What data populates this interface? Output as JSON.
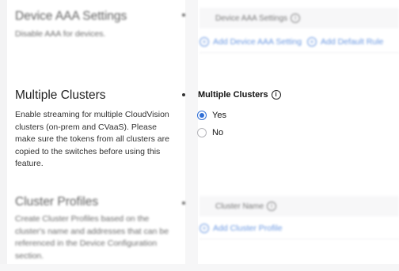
{
  "device_aaa": {
    "title": "Device AAA Settings",
    "description": "Disable AAA for devices.",
    "table_header": "Device AAA Settings",
    "add_setting_label": "Add Device AAA Setting",
    "add_default_rule_label": "Add Default Rule"
  },
  "multiple_clusters": {
    "title": "Multiple Clusters",
    "description": "Enable streaming for multiple CloudVision clusters (on-prem and CVaaS). Please make sure the tokens from all clusters are copied to the switches before using this feature.",
    "field_label": "Multiple Clusters",
    "options": [
      {
        "label": "Yes",
        "selected": true
      },
      {
        "label": "No",
        "selected": false
      }
    ]
  },
  "cluster_profiles": {
    "title": "Cluster Profiles",
    "description": "Create Cluster Profiles based on the cluster's name and addresses that can be referenced in the Device Configuration section.",
    "table_header": "Cluster Name",
    "add_profile_label": "Add Cluster Profile"
  },
  "colors": {
    "accent": "#2f6fd6"
  }
}
